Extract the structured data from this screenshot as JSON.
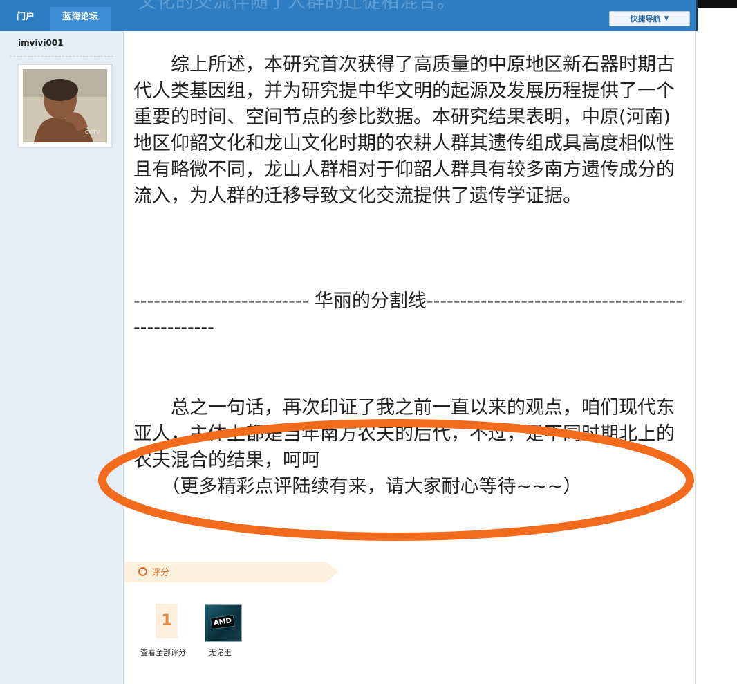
{
  "header": {
    "partial_title": "文化的交流伴随了人群的迁徙相混合。",
    "nav": [
      {
        "label": "门户"
      },
      {
        "label": "蓝海论坛"
      }
    ],
    "quick_nav_label": "快捷导航"
  },
  "user": {
    "name": "imvivi001"
  },
  "post": {
    "paragraph1": "　　综上所述，本研究首次获得了高质量的中原地区新石器时期古代人类基因组，并为研究提中华文明的起源及发展历程提供了一个重要的时间、空间节点的参比数据。本研究结果表明，中原(河南)地区仰韶文化和龙山文化时期的农耕人群其遗传组成具高度相似性且有略微不同，龙山人群相对于仰韶人群具有较多南方遗传成分的流入，为人群的迁移导致文化交流提供了遗传学证据。",
    "divider": "  -------------------------- 华丽的分割线--------------------------------------------------",
    "paragraph2": "　　总之一句话，再次印证了我之前一直以来的观点，咱们现代东亚人，主体上都是当年南方农夫的后代，不过，是不同时期北上的农夫混合的结果，呵呵",
    "paragraph3": "　　（更多精彩点评陆续有来，请大家耐心等待~~~）"
  },
  "rating": {
    "label": "评分",
    "count": "1",
    "view_all": "查看全部评分",
    "rater_name": "无诸王",
    "rater_avatar_text": "AMD"
  },
  "colors": {
    "nav_blue": "#2e7dc1",
    "annotation_orange": "#f26a1c",
    "rating_orange": "#e06b29"
  }
}
